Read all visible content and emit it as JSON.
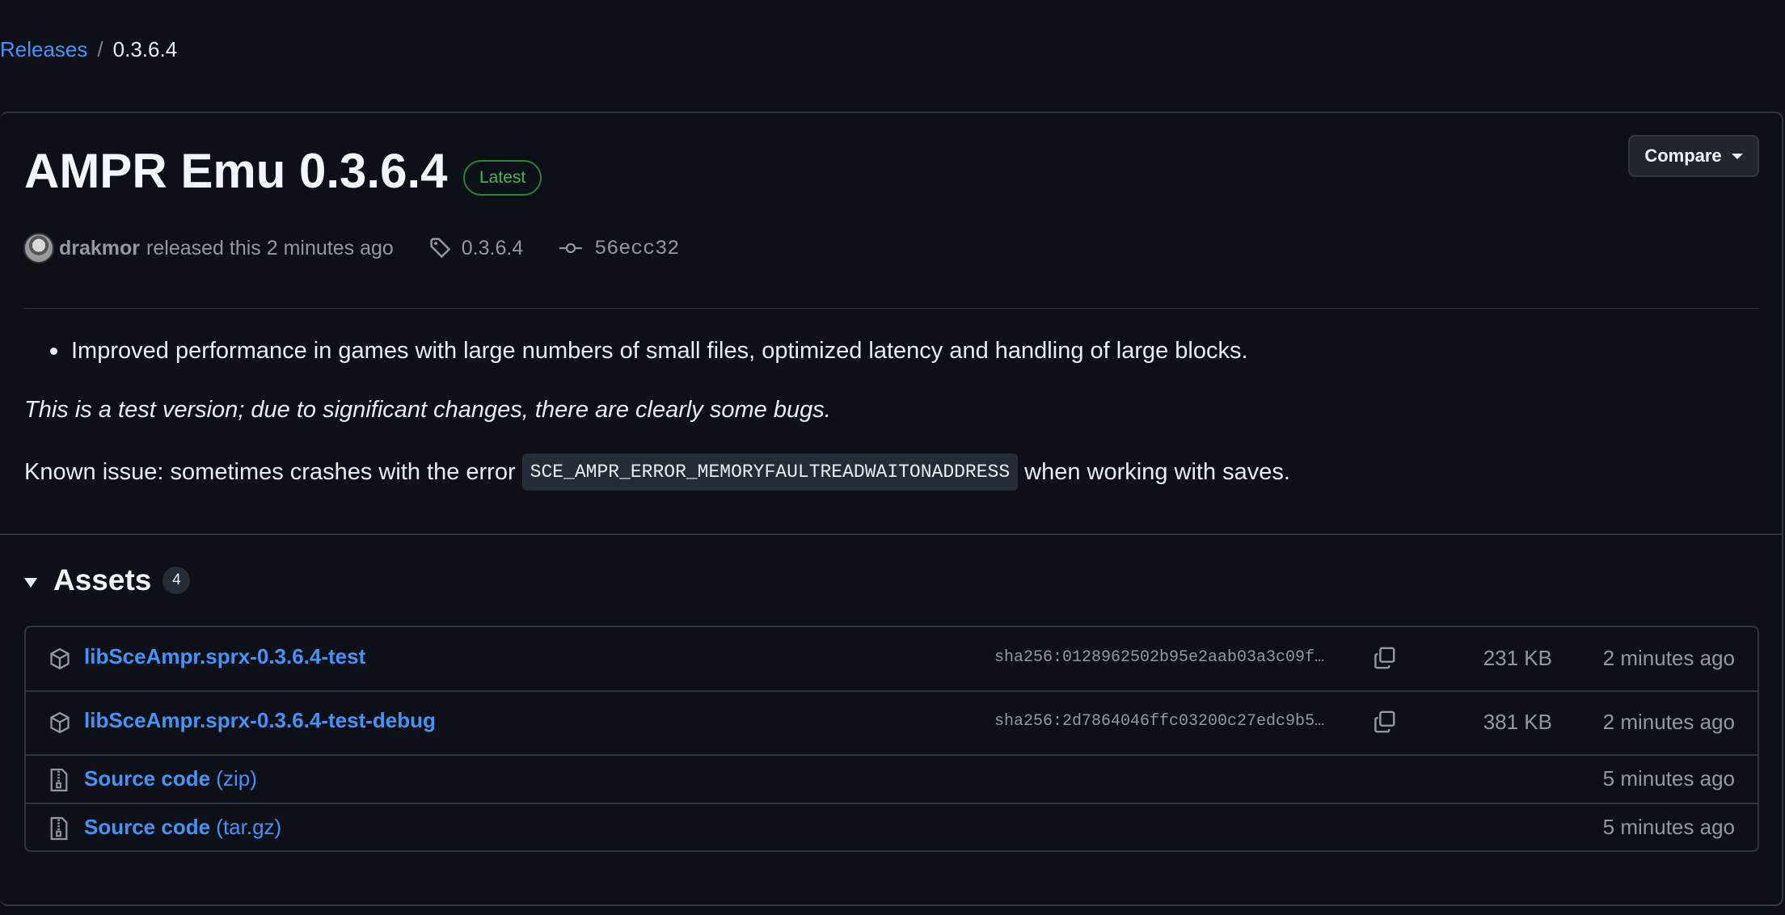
{
  "breadcrumb": {
    "parent": "Releases",
    "separator": "/",
    "current": "0.3.6.4"
  },
  "release": {
    "title": "AMPR Emu 0.3.6.4",
    "badge": "Latest",
    "compare_label": "Compare",
    "author": "drakmor",
    "released_text": "released this 2 minutes ago",
    "tag": "0.3.6.4",
    "commit": "56ecc32"
  },
  "notes": {
    "bullet": "Improved performance in games with large numbers of small files, optimized latency and handling of large blocks.",
    "italic": "This is a test version; due to significant changes, there are clearly some bugs.",
    "known_prefix": "Known issue: sometimes crashes with the error",
    "known_code": "SCE_AMPR_ERROR_MEMORYFAULTREADWAITONADDRESS",
    "known_suffix": "when working with saves."
  },
  "assets": {
    "title": "Assets",
    "count": "4",
    "rows": [
      {
        "name": "libSceAmpr.sprx-0.3.6.4-test",
        "sha": "sha256:0128962502b95e2aab03a3c09f…",
        "size": "231 KB",
        "time": "2 minutes ago",
        "icon": "package-icon"
      },
      {
        "name": "libSceAmpr.sprx-0.3.6.4-test-debug",
        "sha": "sha256:2d7864046ffc03200c27edc9b5…",
        "size": "381 KB",
        "time": "2 minutes ago",
        "icon": "package-icon"
      },
      {
        "name": "Source code",
        "suffix": "(zip)",
        "time": "5 minutes ago",
        "icon": "file-zip-icon"
      },
      {
        "name": "Source code",
        "suffix": "(tar.gz)",
        "time": "5 minutes ago",
        "icon": "file-zip-icon"
      }
    ]
  },
  "colors": {
    "background": "#0d1117",
    "link": "#4493f8",
    "badge_green": "#3fb950",
    "muted": "#9198a1",
    "border": "#30363d"
  }
}
